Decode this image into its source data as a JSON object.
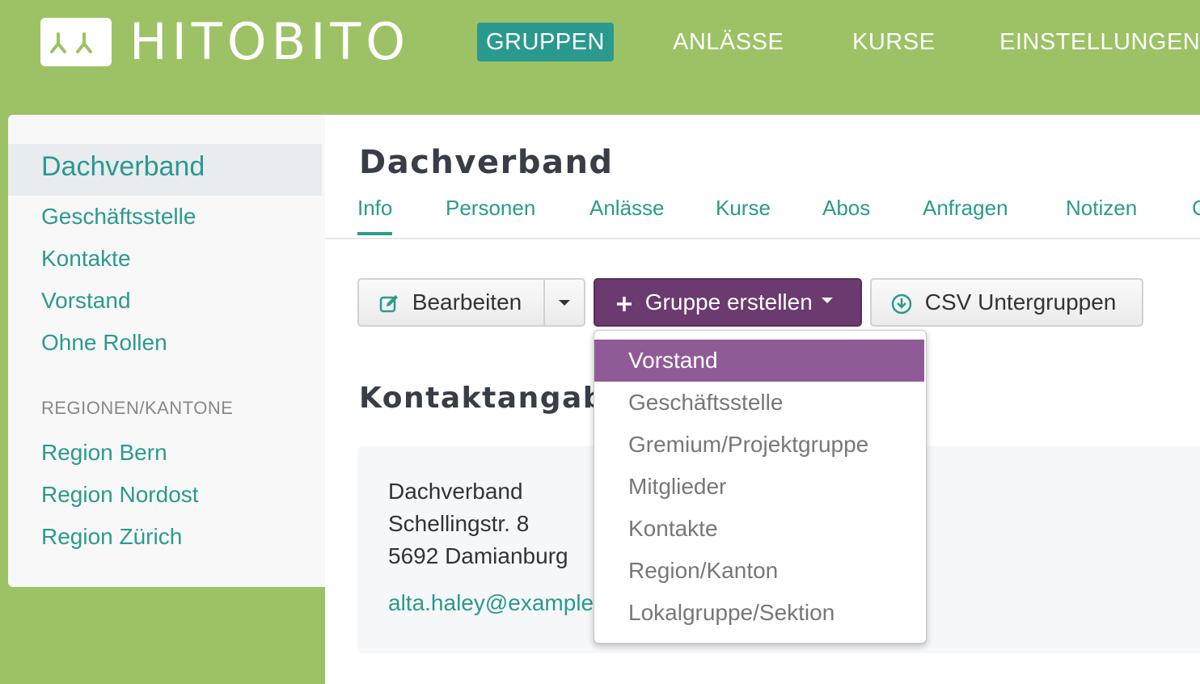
{
  "header": {
    "logo_text": "HITOBITO",
    "nav": [
      {
        "label": "GRUPPEN",
        "active": true
      },
      {
        "label": "ANLÄSSE"
      },
      {
        "label": "KURSE"
      },
      {
        "label": "EINSTELLUNGEN"
      }
    ]
  },
  "sidebar": {
    "top": "Dachverband",
    "links": [
      "Geschäftsstelle",
      "Kontakte",
      "Vorstand",
      "Ohne Rollen"
    ],
    "heading": "REGIONEN/KANTONE",
    "regions": [
      "Region Bern",
      "Region Nordost",
      "Region Zürich"
    ]
  },
  "main": {
    "title": "Dachverband",
    "tabs": [
      "Info",
      "Personen",
      "Anlässe",
      "Kurse",
      "Abos",
      "Anfragen",
      "Notizen",
      "C"
    ],
    "active_tab": "Info",
    "buttons": {
      "edit": "Bearbeiten",
      "create_group": "Gruppe erstellen",
      "csv": "CSV Untergruppen"
    },
    "section_title": "Kontaktangabe",
    "contact": {
      "name": "Dachverband",
      "street": "Schellingstr. 8",
      "city": "5692 Damianburg",
      "email": "alta.haley@example"
    }
  },
  "dropdown": {
    "items": [
      "Vorstand",
      "Geschäftsstelle",
      "Gremium/Projektgruppe",
      "Mitglieder",
      "Kontakte",
      "Region/Kanton",
      "Lokalgruppe/Sektion"
    ],
    "highlighted": "Vorstand"
  },
  "colors": {
    "header_bg": "#9cc265",
    "accent": "#2a9a8e",
    "primary_button": "#6b3a6f",
    "dropdown_highlight": "#8f5b96"
  }
}
